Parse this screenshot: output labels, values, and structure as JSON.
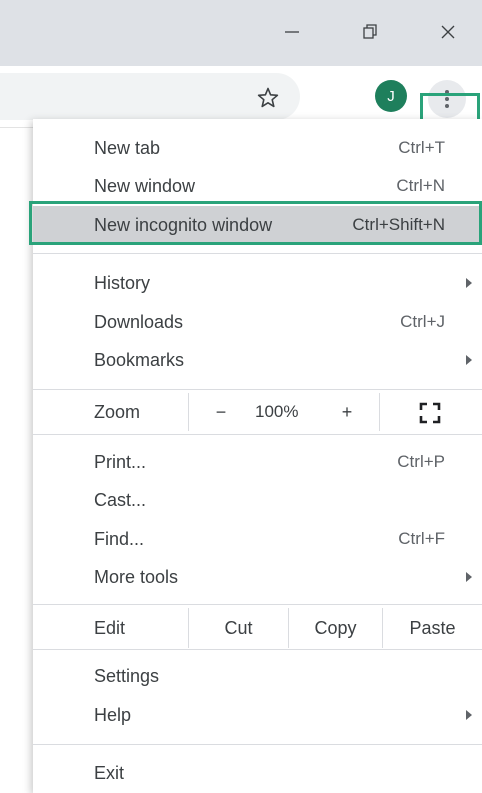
{
  "window_controls": {
    "minimize_icon": "minimize-icon",
    "restore_icon": "restore-icon",
    "close_icon": "close-icon"
  },
  "toolbar": {
    "avatar_initial": "J",
    "avatar_color": "#1e7f5c",
    "bookmark_icon": "star-icon",
    "menu_icon": "three-dots-vertical-icon"
  },
  "menu": {
    "new_tab": {
      "label": "New tab",
      "shortcut": "Ctrl+T"
    },
    "new_window": {
      "label": "New window",
      "shortcut": "Ctrl+N"
    },
    "new_incognito": {
      "label": "New incognito window",
      "shortcut": "Ctrl+Shift+N"
    },
    "history": {
      "label": "History"
    },
    "downloads": {
      "label": "Downloads",
      "shortcut": "Ctrl+J"
    },
    "bookmarks": {
      "label": "Bookmarks"
    },
    "zoom": {
      "label": "Zoom",
      "minus": "−",
      "value": "100%",
      "plus": "+"
    },
    "print": {
      "label": "Print...",
      "shortcut": "Ctrl+P"
    },
    "cast": {
      "label": "Cast..."
    },
    "find": {
      "label": "Find...",
      "shortcut": "Ctrl+F"
    },
    "more_tools": {
      "label": "More tools"
    },
    "edit": {
      "label": "Edit",
      "cut": "Cut",
      "copy": "Copy",
      "paste": "Paste"
    },
    "settings": {
      "label": "Settings"
    },
    "help": {
      "label": "Help"
    },
    "exit": {
      "label": "Exit"
    }
  },
  "highlight_color": "#2aa37a"
}
